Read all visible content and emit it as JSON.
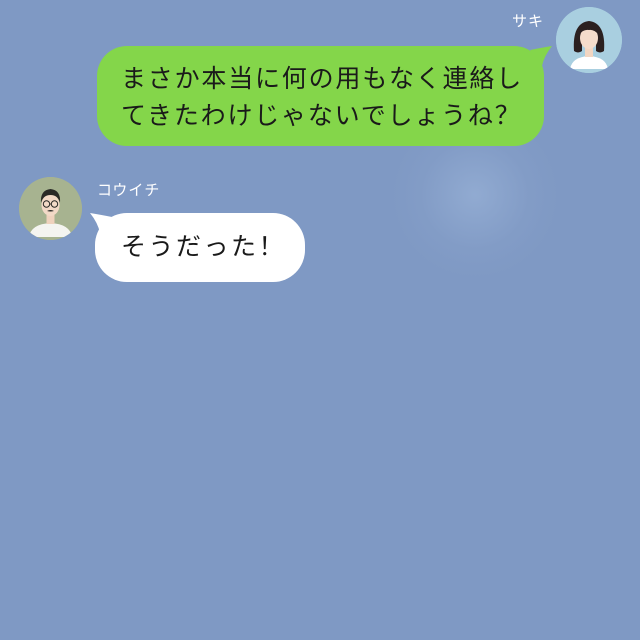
{
  "colors": {
    "background": "#7f99c4",
    "sent_bubble": "#84d64a",
    "received_bubble": "#ffffff",
    "name_text": "#ffffff",
    "message_text": "#1a1a1a"
  },
  "messages": [
    {
      "sender": "サキ",
      "side": "right",
      "avatar": "woman-avatar-icon",
      "lines": [
        "まさか本当に何の用もなく連絡し",
        "てきたわけじゃないでしょうね？"
      ]
    },
    {
      "sender": "コウイチ",
      "side": "left",
      "avatar": "man-avatar-icon",
      "lines": [
        "そうだった！"
      ]
    }
  ]
}
